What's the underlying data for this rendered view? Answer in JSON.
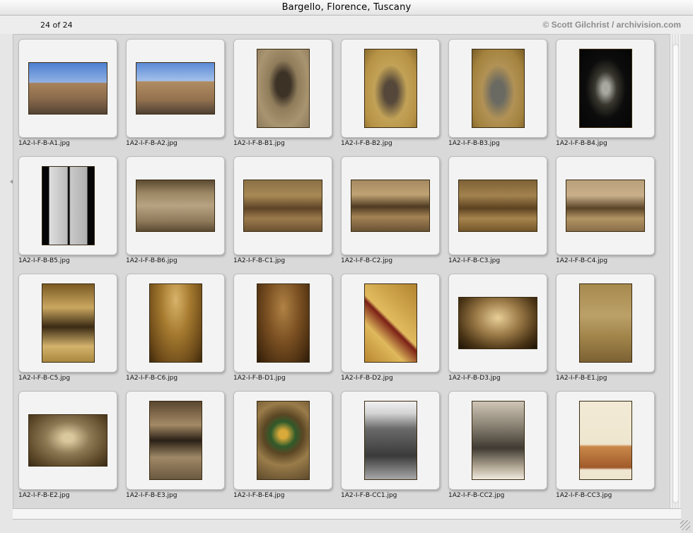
{
  "window": {
    "title": "Bargello, Florence, Tuscany"
  },
  "header": {
    "count": "24 of 24",
    "credit": "© Scott Gilchrist / archivision.com"
  },
  "items": [
    {
      "filename": "1A2-I-F-B-A1.jpg",
      "orientation": "land",
      "style": "p-plaza"
    },
    {
      "filename": "1A2-I-F-B-A2.jpg",
      "orientation": "land",
      "style": "p-plaza2"
    },
    {
      "filename": "1A2-I-F-B-B1.jpg",
      "orientation": "port",
      "style": "p-window1"
    },
    {
      "filename": "1A2-I-F-B-B2.jpg",
      "orientation": "port",
      "style": "p-window2"
    },
    {
      "filename": "1A2-I-F-B-B3.jpg",
      "orientation": "port",
      "style": "p-window3"
    },
    {
      "filename": "1A2-I-F-B-B4.jpg",
      "orientation": "port",
      "style": "p-window4"
    },
    {
      "filename": "1A2-I-F-B-B5.jpg",
      "orientation": "port",
      "style": "p-stained"
    },
    {
      "filename": "1A2-I-F-B-B6.jpg",
      "orientation": "land",
      "style": "p-relief"
    },
    {
      "filename": "1A2-I-F-B-C1.jpg",
      "orientation": "land",
      "style": "p-court1"
    },
    {
      "filename": "1A2-I-F-B-C2.jpg",
      "orientation": "land",
      "style": "p-court2"
    },
    {
      "filename": "1A2-I-F-B-C3.jpg",
      "orientation": "land",
      "style": "p-court3"
    },
    {
      "filename": "1A2-I-F-B-C4.jpg",
      "orientation": "land",
      "style": "p-court4"
    },
    {
      "filename": "1A2-I-F-B-C5.jpg",
      "orientation": "port",
      "style": "p-stair1"
    },
    {
      "filename": "1A2-I-F-B-C6.jpg",
      "orientation": "port",
      "style": "p-vault1"
    },
    {
      "filename": "1A2-I-F-B-D1.jpg",
      "orientation": "port",
      "style": "p-vault2"
    },
    {
      "filename": "1A2-I-F-B-D2.jpg",
      "orientation": "port",
      "style": "p-ceiling"
    },
    {
      "filename": "1A2-I-F-B-D3.jpg",
      "orientation": "land",
      "style": "p-hall"
    },
    {
      "filename": "1A2-I-F-B-E1.jpg",
      "orientation": "port",
      "style": "p-wall"
    },
    {
      "filename": "1A2-I-F-B-E2.jpg",
      "orientation": "land",
      "style": "p-crest"
    },
    {
      "filename": "1A2-I-F-B-E3.jpg",
      "orientation": "port",
      "style": "p-arches"
    },
    {
      "filename": "1A2-I-F-B-E4.jpg",
      "orientation": "port",
      "style": "p-medal"
    },
    {
      "filename": "1A2-I-F-B-CC1.jpg",
      "orientation": "port",
      "style": "p-bw1"
    },
    {
      "filename": "1A2-I-F-B-CC2.jpg",
      "orientation": "port",
      "style": "p-bw2"
    },
    {
      "filename": "1A2-I-F-B-CC3.jpg",
      "orientation": "port",
      "style": "p-print"
    }
  ]
}
